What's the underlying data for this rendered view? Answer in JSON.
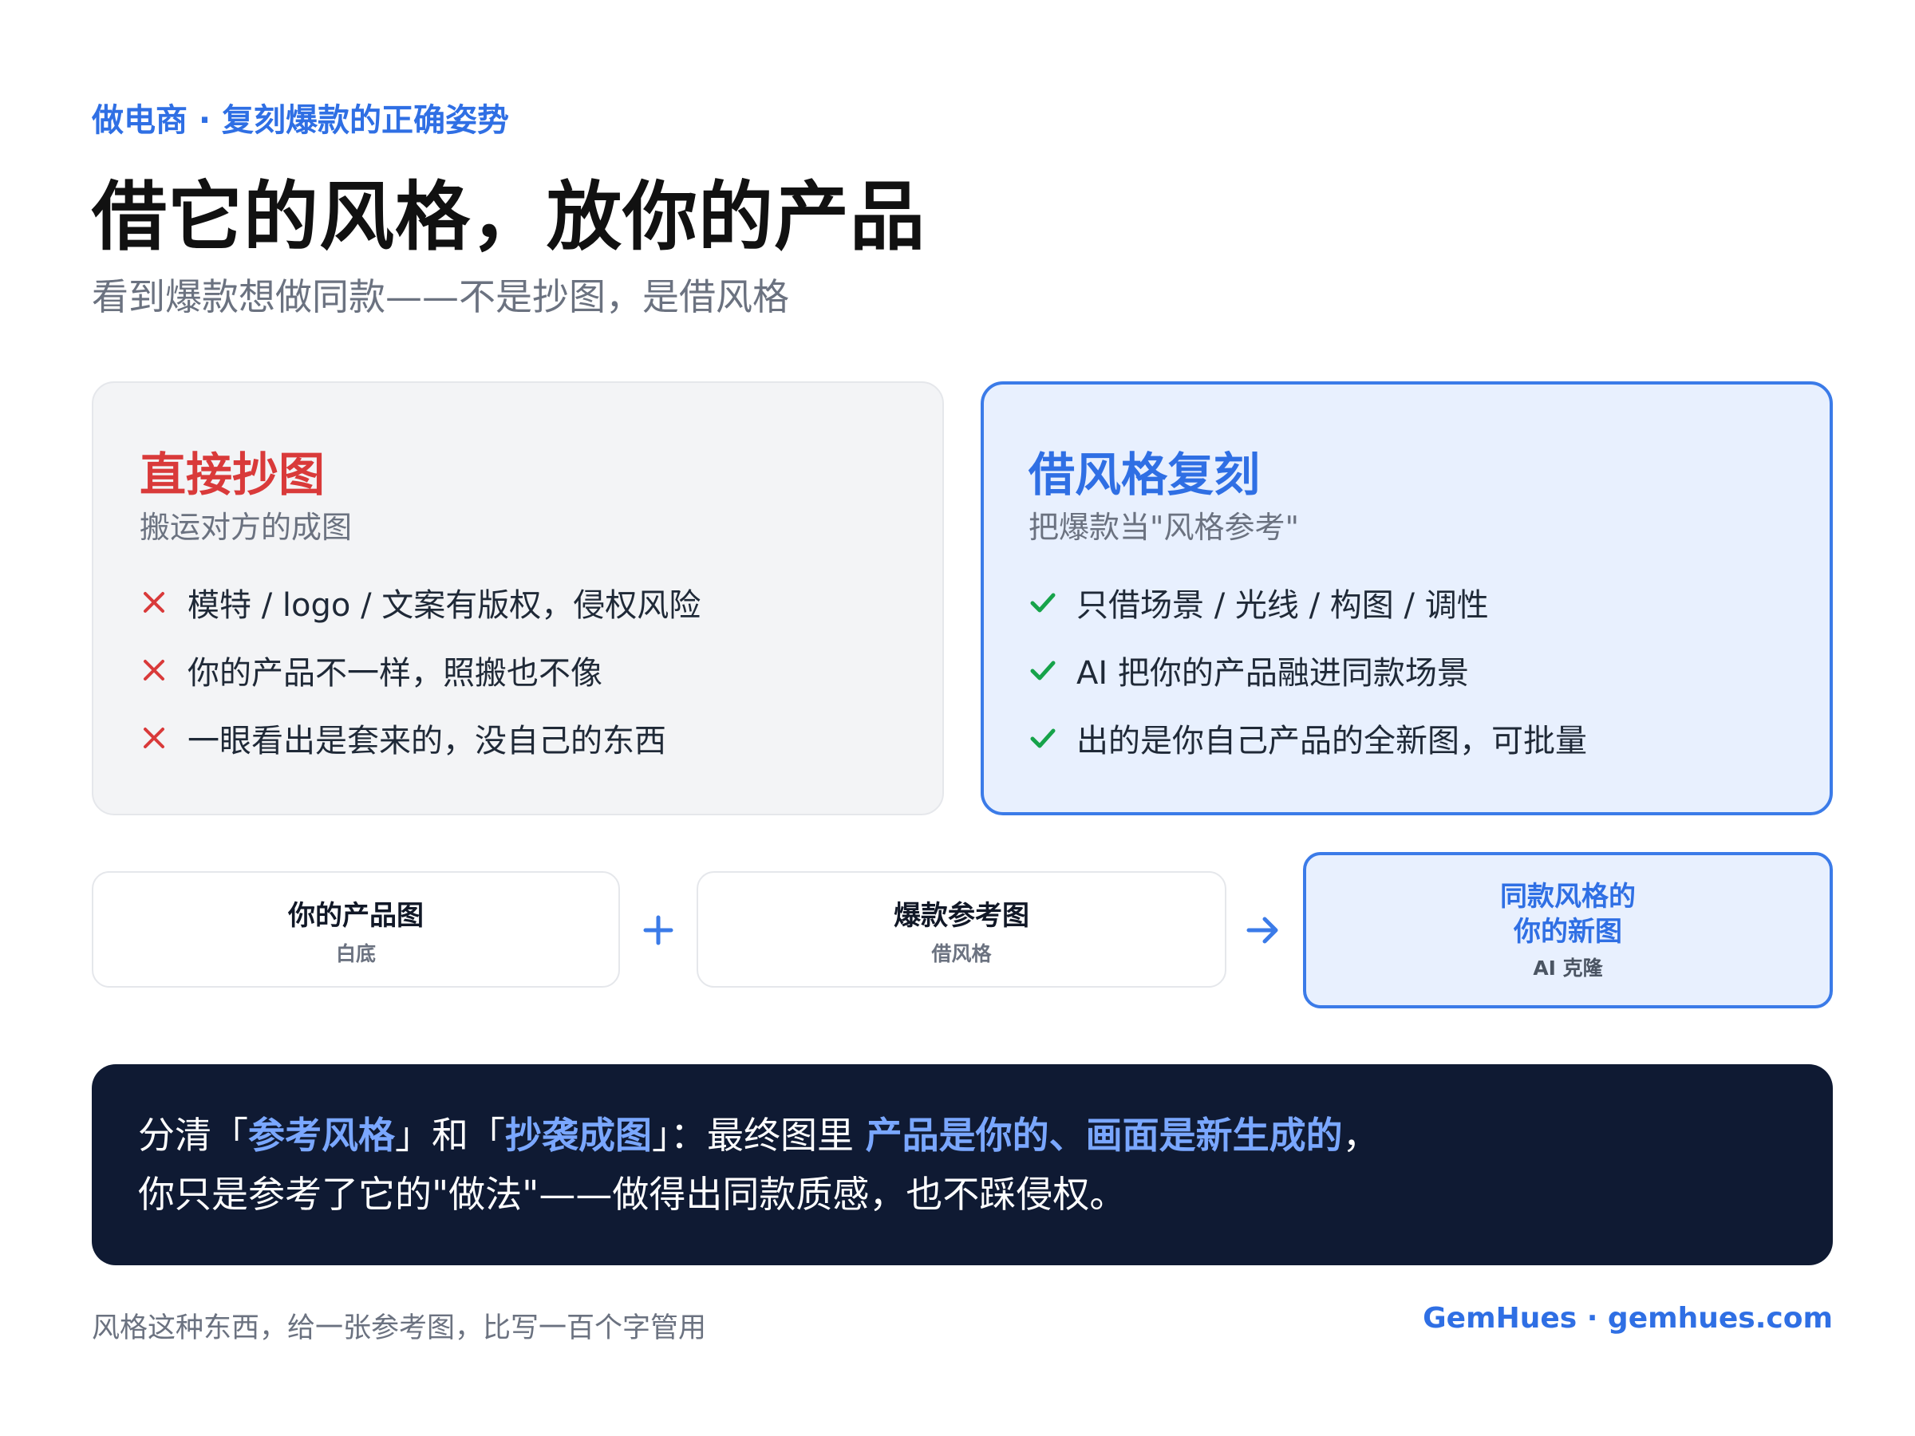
{
  "header": {
    "eyebrow": "做电商 · 复刻爆款的正确姿势",
    "title": "借它的风格，放你的产品",
    "subtitle": "看到爆款想做同款——不是抄图，是借风格"
  },
  "cards": {
    "left": {
      "title": "直接抄图",
      "description": "搬运对方的成图",
      "items": [
        "模特 / logo / 文案有版权，侵权风险",
        "你的产品不一样，照搬也不像",
        "一眼看出是套来的，没自己的东西"
      ],
      "icon": "cross-icon"
    },
    "right": {
      "title": "借风格复刻",
      "description": "把爆款当\"风格参考\"",
      "items": [
        "只借场景 / 光线 / 构图 / 调性",
        "AI 把你的产品融进同款场景",
        "出的是你自己产品的全新图，可批量"
      ],
      "icon": "check-icon"
    }
  },
  "flow": {
    "steps": [
      {
        "label": "你的产品图",
        "sub": "白底"
      },
      {
        "label": "爆款参考图",
        "sub": "借风格"
      },
      {
        "label": "同款风格的\n你的新图",
        "sub": "AI 克隆"
      }
    ],
    "plus_icon": "plus-icon",
    "arrow_icon": "arrow-right-icon"
  },
  "callout": {
    "line1": [
      {
        "text": "分清「",
        "highlight": false
      },
      {
        "text": "参考风格",
        "highlight": true
      },
      {
        "text": "」和「",
        "highlight": false
      },
      {
        "text": "抄袭成图",
        "highlight": true
      },
      {
        "text": "」：最终图里 ",
        "highlight": false
      },
      {
        "text": "产品是你的、画面是新生成的",
        "highlight": true
      },
      {
        "text": "，",
        "highlight": false
      }
    ],
    "line2": "你只是参考了它的\"做法\"——做得出同款质感，也不踩侵权。"
  },
  "footer": {
    "left": "风格这种东西，给一张参考图，比写一百个字管用",
    "right": "GemHues · gemhues.com"
  },
  "colors": {
    "accent": "#2f6fe4",
    "danger": "#d93a3a",
    "success": "#16a34a",
    "dark": "#0f1a33",
    "highlight": "#7aa7ff"
  }
}
